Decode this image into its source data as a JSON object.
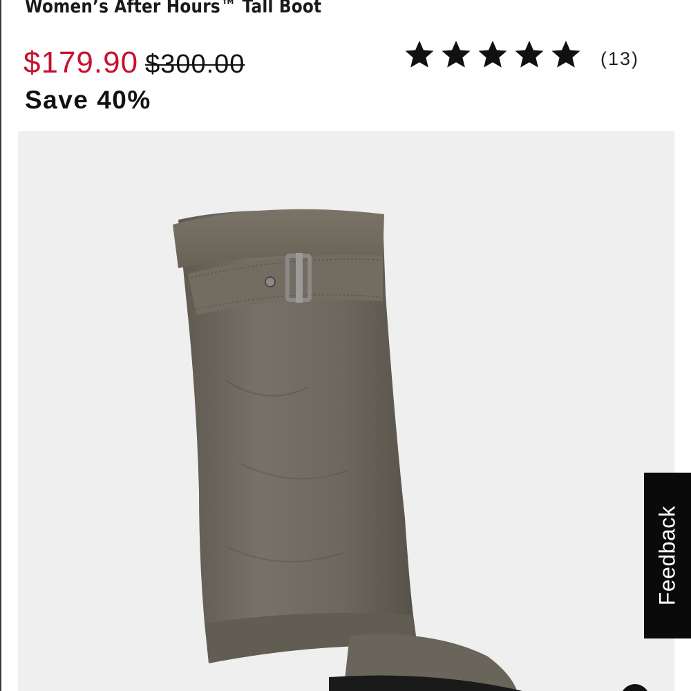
{
  "product": {
    "title": "Women’s After Hours™ Tall Boot",
    "sale_price": "$179.90",
    "original_price": "$300.00",
    "savings": "Save 40%"
  },
  "rating": {
    "stars": 5,
    "max_stars": 5,
    "review_count": "(13)"
  },
  "feedback": {
    "label": "Feedback"
  },
  "icons": {
    "star": "star-icon",
    "next": "carousel-next-icon"
  },
  "colors": {
    "sale_price": "#c8102e",
    "text": "#111111",
    "image_background": "#efefef",
    "feedback_background": "#0a0a0a",
    "boot_leather": "#6f6a5e"
  }
}
